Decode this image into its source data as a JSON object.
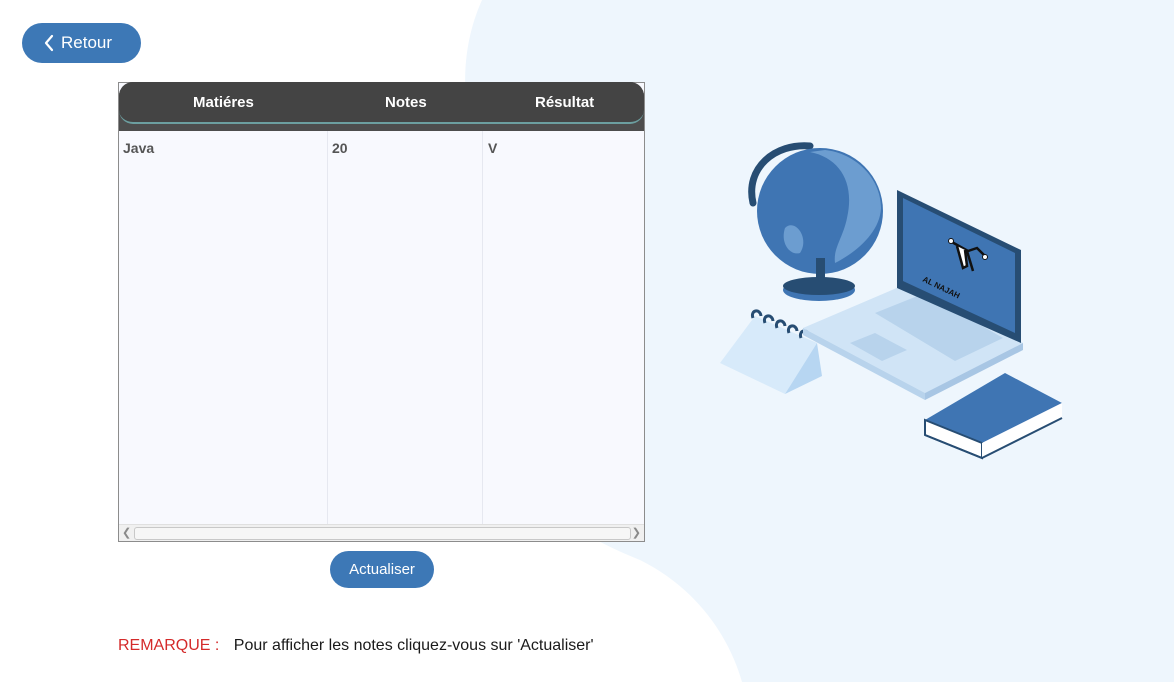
{
  "nav": {
    "back_label": "Retour",
    "back_icon": "chevron-left-icon"
  },
  "grid": {
    "columns": [
      "Matiéres",
      "Notes",
      "Résultat"
    ],
    "rows": [
      {
        "matiere": "Java",
        "note": "20",
        "resultat": "V"
      }
    ]
  },
  "actions": {
    "refresh_label": "Actualiser"
  },
  "remark": {
    "label": "REMARQUE :",
    "text": "Pour afficher les notes cliquez-vous sur 'Actualiser'"
  },
  "illustration": {
    "logo_text": "AL NAJAH"
  },
  "colors": {
    "accent": "#3d78b6",
    "header": "#444444",
    "background_blob": "#eef6fd",
    "remark_label": "#d42a2a"
  }
}
